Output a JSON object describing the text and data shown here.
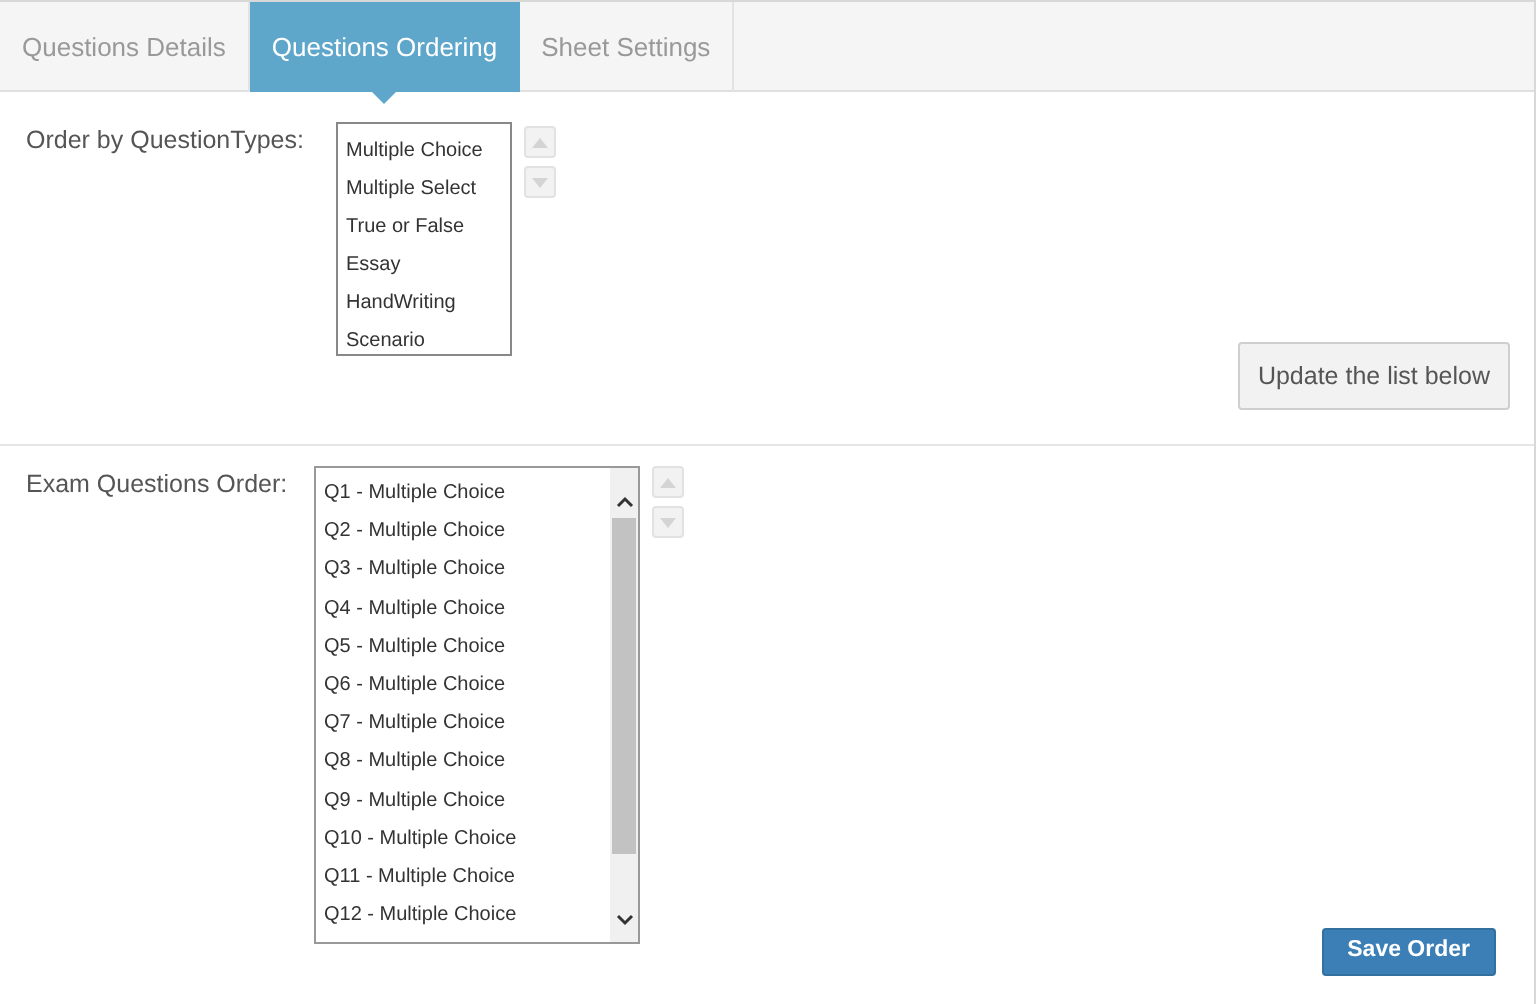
{
  "tabs": [
    {
      "label": "Questions Details",
      "selected": false
    },
    {
      "label": "Questions Ordering",
      "selected": true
    },
    {
      "label": "Sheet Settings",
      "selected": false
    }
  ],
  "type_order": {
    "label": "Order by QuestionTypes:",
    "items": [
      "Multiple Choice",
      "Multiple Select",
      "True or False",
      "Essay",
      "HandWriting",
      "Scenario"
    ],
    "button": "Update the list below"
  },
  "exam_order": {
    "label": "Exam Questions Order:",
    "items": [
      "Q1 - Multiple Choice",
      "Q2 - Multiple Choice",
      "Q3 - Multiple Choice",
      "Q4 - Multiple Choice",
      "Q5 - Multiple Choice",
      "Q6 - Multiple Choice",
      "Q7 - Multiple Choice",
      "Q8 - Multiple Choice",
      "Q9 - Multiple Choice",
      "Q10 - Multiple Choice",
      "Q11 - Multiple Choice",
      "Q12 - Multiple Choice"
    ],
    "button": "Save Order"
  }
}
